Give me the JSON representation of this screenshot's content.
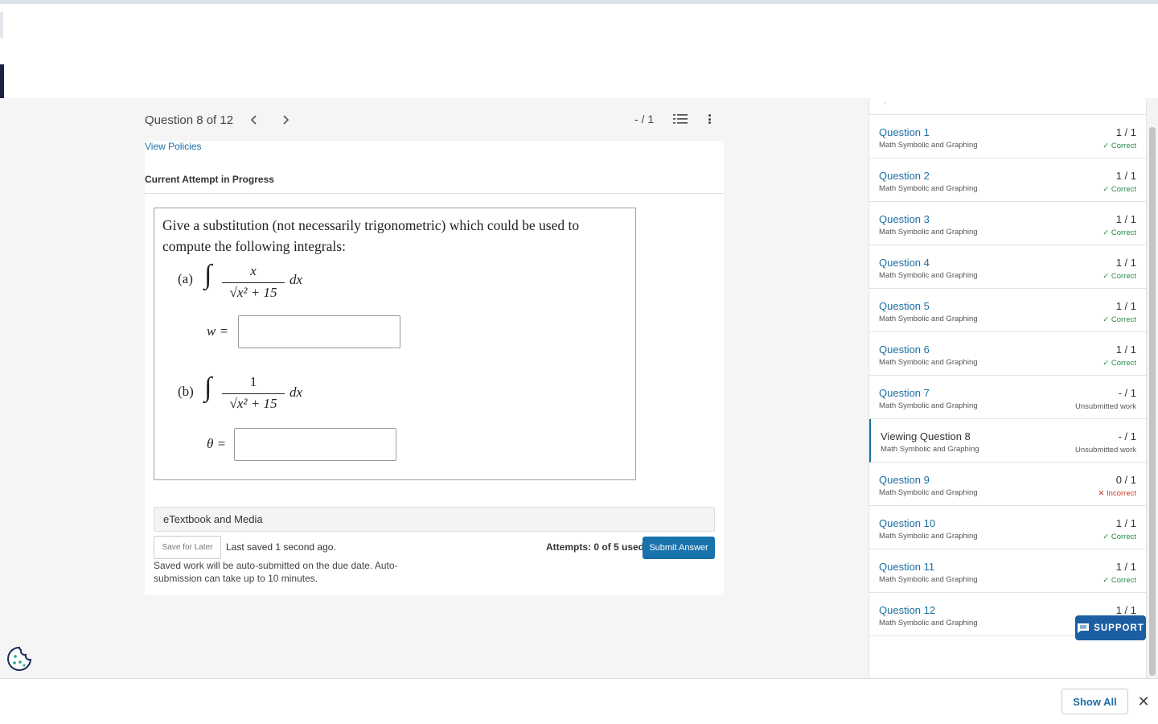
{
  "question_nav": {
    "title": "Question 8 of 12",
    "prev_icon": "chevron-left-icon",
    "next_icon": "chevron-right-icon",
    "score": "- / 1",
    "list_icon": "numbered-list-icon",
    "more_icon": "more-vertical-icon"
  },
  "main": {
    "view_policies": "View Policies",
    "attempt_heading": "Current Attempt in Progress",
    "prompt": "Give a substitution (not necessarily trigonometric) which could be used to compute the following integrals:",
    "parts": [
      {
        "label": "(a)",
        "numerator": "x",
        "denominator": "√x² + 15",
        "differential": "dx",
        "variable": "w =",
        "answer": ""
      },
      {
        "label": "(b)",
        "numerator": "1",
        "denominator": "√x² + 15",
        "differential": "dx",
        "variable": "θ =",
        "answer": ""
      }
    ],
    "etextbook": "eTextbook and Media",
    "save_later": "Save for Later",
    "last_saved": "Last saved 1 second ago.",
    "attempts": "Attempts: 0 of 5 used",
    "submit": "Submit Answer",
    "autosubmit_note": "Saved work will be auto-submitted on the due date. Auto-submission can take up to 10 minutes."
  },
  "sidebar": {
    "items": [
      {
        "name": "Question 1",
        "type": "Math Symbolic and Graphing",
        "points": "1 / 1",
        "status": "✓ Correct",
        "state": "ok"
      },
      {
        "name": "Question 2",
        "type": "Math Symbolic and Graphing",
        "points": "1 / 1",
        "status": "✓ Correct",
        "state": "ok"
      },
      {
        "name": "Question 3",
        "type": "Math Symbolic and Graphing",
        "points": "1 / 1",
        "status": "✓ Correct",
        "state": "ok"
      },
      {
        "name": "Question 4",
        "type": "Math Symbolic and Graphing",
        "points": "1 / 1",
        "status": "✓ Correct",
        "state": "ok"
      },
      {
        "name": "Question 5",
        "type": "Math Symbolic and Graphing",
        "points": "1 / 1",
        "status": "✓ Correct",
        "state": "ok"
      },
      {
        "name": "Question 6",
        "type": "Math Symbolic and Graphing",
        "points": "1 / 1",
        "status": "✓ Correct",
        "state": "ok"
      },
      {
        "name": "Question 7",
        "type": "Math Symbolic and Graphing",
        "points": "- / 1",
        "status": "Unsubmitted work",
        "state": "none"
      },
      {
        "name": "Viewing Question 8",
        "type": "Math Symbolic and Graphing",
        "points": "- / 1",
        "status": "Unsubmitted work",
        "state": "current"
      },
      {
        "name": "Question 9",
        "type": "Math Symbolic and Graphing",
        "points": "0 / 1",
        "status": "✕ Incorrect",
        "state": "bad"
      },
      {
        "name": "Question 10",
        "type": "Math Symbolic and Graphing",
        "points": "1 / 1",
        "status": "✓ Correct",
        "state": "ok"
      },
      {
        "name": "Question 11",
        "type": "Math Symbolic and Graphing",
        "points": "1 / 1",
        "status": "✓ Correct",
        "state": "ok"
      },
      {
        "name": "Question 12",
        "type": "Math Symbolic and Graphing",
        "points": "1 / 1",
        "status": "",
        "state": "ok"
      }
    ]
  },
  "support": {
    "label": "SUPPORT",
    "icon": "chat-bubble-icon"
  },
  "cookie_icon": "cookie-icon",
  "bottom": {
    "show_all": "Show All",
    "close_icon": "close-icon"
  },
  "colors": {
    "link": "#1a6fa3",
    "submit": "#1872ac",
    "support": "#1b5fa2",
    "correct": "#2a8a4a",
    "incorrect": "#c0392b",
    "navy": "#1b2144"
  }
}
